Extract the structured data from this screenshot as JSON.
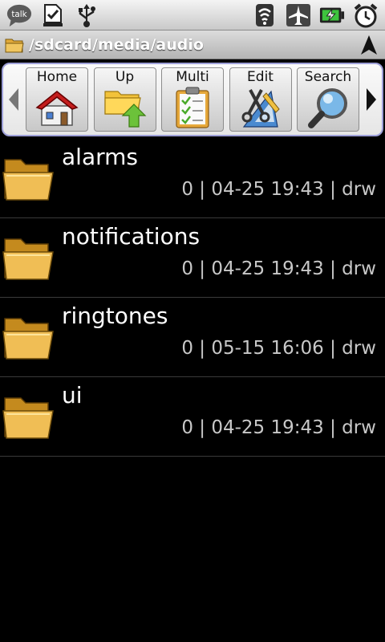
{
  "status_bar": {
    "icons_left": [
      "talk-icon",
      "download-done-icon",
      "usb-icon"
    ],
    "talk_label": "talk",
    "icons_right": [
      "wifi-icon",
      "airplane-mode-icon",
      "battery-charging-icon",
      "alarm-clock-icon"
    ]
  },
  "path_bar": {
    "path": "/sdcard/media/audio"
  },
  "toolbar": {
    "buttons": [
      {
        "label": "Home",
        "icon": "home-icon"
      },
      {
        "label": "Up",
        "icon": "folder-up-icon"
      },
      {
        "label": "Multi",
        "icon": "multi-select-icon"
      },
      {
        "label": "Edit",
        "icon": "edit-tools-icon"
      },
      {
        "label": "Search",
        "icon": "magnifier-icon"
      }
    ]
  },
  "files": [
    {
      "name": "alarms",
      "meta": "0 | 04-25 19:43 | drw"
    },
    {
      "name": "notifications",
      "meta": "0 | 04-25 19:43 | drw"
    },
    {
      "name": "ringtones",
      "meta": "0 | 05-15 16:06 | drw"
    },
    {
      "name": "ui",
      "meta": "0 | 04-25 19:43 | drw"
    }
  ],
  "colors": {
    "background": "#000000",
    "folder": "#e0a93a",
    "toolbar_border": "#9ea0d8",
    "meta_text": "#c8c8c8"
  }
}
